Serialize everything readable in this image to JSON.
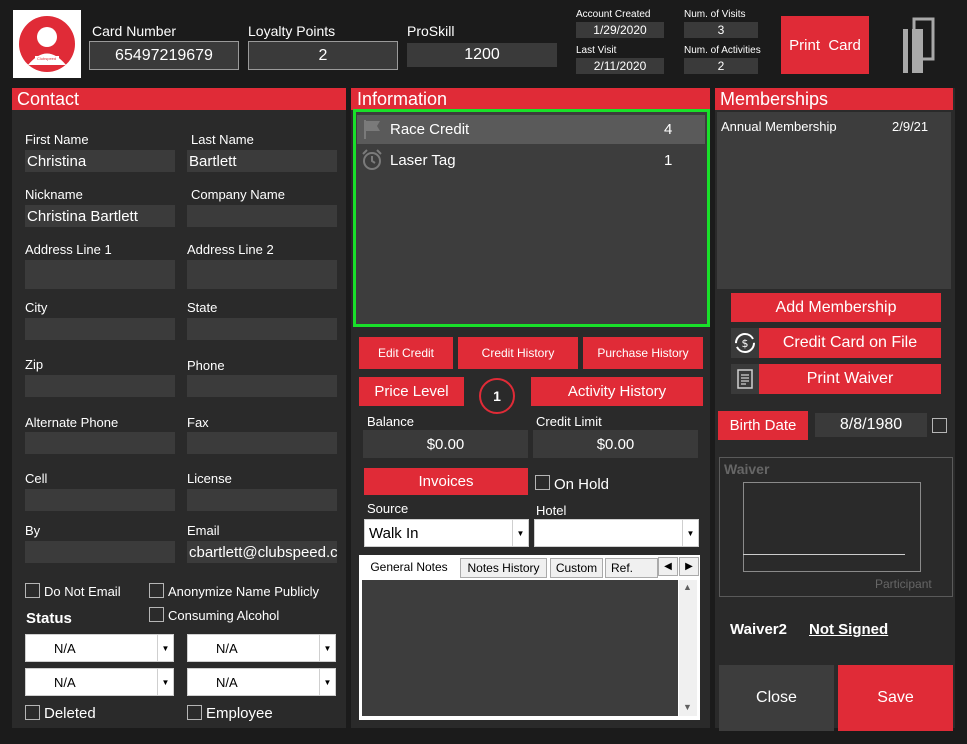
{
  "header": {
    "card_number_label": "Card Number",
    "card_number": "65497219679",
    "loyalty_label": "Loyalty Points",
    "loyalty_points": "2",
    "proskill_label": "ProSkill",
    "proskill": "1200",
    "account_created_label": "Account Created",
    "account_created": "1/29/2020",
    "last_visit_label": "Last Visit",
    "last_visit": "2/11/2020",
    "num_visits_label": "Num. of Visits",
    "num_visits": "3",
    "num_activities_label": "Num. of Activities",
    "num_activities": "2",
    "print_card": "Print  Card",
    "avatar_brand": "Clubspeed"
  },
  "contact": {
    "title": "Contact",
    "first_name_label": "First Name",
    "first_name": "Christina",
    "last_name_label": "Last Name",
    "last_name": "Bartlett",
    "nickname_label": "Nickname",
    "nickname": "Christina Bartlett",
    "company_label": "Company Name",
    "company": "",
    "address1_label": "Address Line 1",
    "address1": "",
    "address2_label": "Address Line 2",
    "address2": "",
    "city_label": "City",
    "city": "",
    "state_label": "State",
    "state": "",
    "zip_label": "Zip",
    "zip": "",
    "phone_label": "Phone",
    "phone": "",
    "alt_phone_label": "Alternate Phone",
    "alt_phone": "",
    "fax_label": "Fax",
    "fax": "",
    "cell_label": "Cell",
    "cell": "",
    "license_label": "License",
    "license": "",
    "by_label": "By",
    "by": "",
    "email_label": "Email",
    "email": "cbartlett@clubspeed.com",
    "do_not_email": "Do Not Email",
    "anonymize": "Anonymize Name Publicly",
    "consuming_alcohol": "Consuming Alcohol",
    "status_label": "Status",
    "status1": "N/A",
    "status2": "N/A",
    "status3": "N/A",
    "status4": "N/A",
    "deleted": "Deleted",
    "employee": "Employee"
  },
  "information": {
    "title": "Information",
    "items": [
      {
        "name": "Race Credit",
        "count": "4"
      },
      {
        "name": "Laser Tag",
        "count": "1"
      }
    ],
    "edit_credit": "Edit Credit",
    "credit_history": "Credit History",
    "purchase_history": "Purchase History",
    "price_level": "Price Level",
    "price_level_badge": "1",
    "activity_history": "Activity History",
    "balance_label": "Balance",
    "balance": "$0.00",
    "credit_limit_label": "Credit Limit",
    "credit_limit": "$0.00",
    "invoices": "Invoices",
    "on_hold": "On Hold",
    "source_label": "Source",
    "source": "Walk In",
    "hotel_label": "Hotel",
    "hotel": "",
    "tabs": [
      "General Notes",
      "Notes History",
      "Custom",
      "Ref."
    ]
  },
  "memberships": {
    "title": "Memberships",
    "items": [
      {
        "name": "Annual Membership",
        "date": "2/9/21"
      }
    ],
    "add_membership": "Add Membership",
    "credit_card_on_file": "Credit Card on File",
    "print_waiver": "Print Waiver",
    "birth_date_label": "Birth Date",
    "birth_date": "8/8/1980",
    "waiver_label": "Waiver",
    "participant": "Participant",
    "waiver2_label": "Waiver2",
    "waiver2_status": "Not Signed",
    "close": "Close",
    "save": "Save"
  },
  "colors": {
    "accent": "#e02b37",
    "highlight": "#19e02a"
  }
}
